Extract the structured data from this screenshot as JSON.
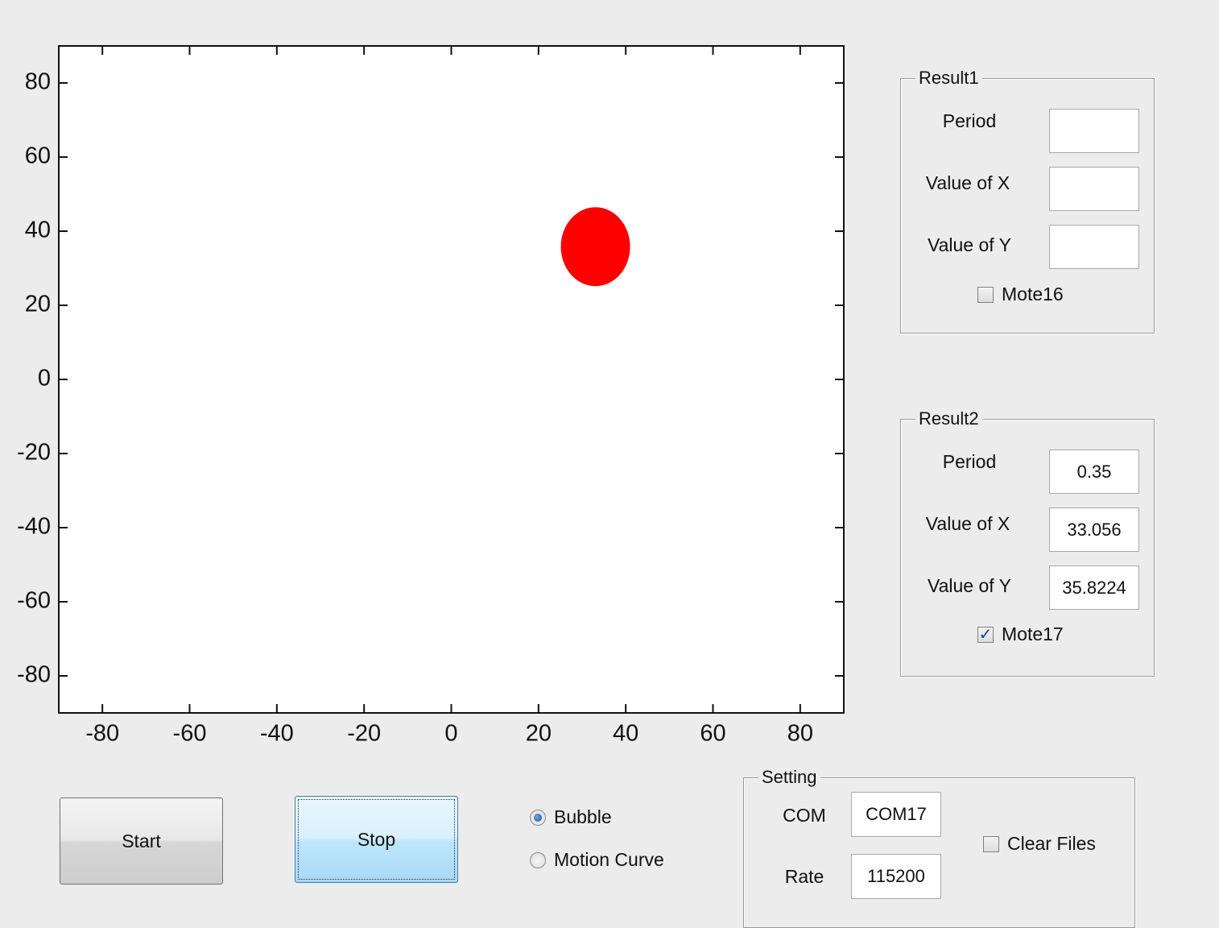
{
  "chart_data": {
    "type": "scatter",
    "xlim": [
      -90,
      90
    ],
    "ylim": [
      -90,
      90
    ],
    "xticks": [
      -80,
      -60,
      -40,
      -20,
      0,
      20,
      40,
      60,
      80
    ],
    "yticks": [
      80,
      60,
      40,
      20,
      0,
      -20,
      -40,
      -60,
      -80
    ],
    "points": [
      {
        "x": 33.056,
        "y": 35.8224
      }
    ],
    "marker_color": "#ff0000",
    "marker": "filled circle",
    "grid": false
  },
  "result1": {
    "title": "Result1",
    "period_label": "Period",
    "x_label": "Value of X",
    "y_label": "Value of Y",
    "period_value": "",
    "x_value": "",
    "y_value": "",
    "mote_label": "Mote16",
    "mote_checked": false
  },
  "result2": {
    "title": "Result2",
    "period_label": "Period",
    "x_label": "Value of X",
    "y_label": "Value of Y",
    "period_value": "0.35",
    "x_value": "33.056",
    "y_value": "35.8224",
    "mote_label": "Mote17",
    "mote_checked": true
  },
  "buttons": {
    "start_label": "Start",
    "stop_label": "Stop"
  },
  "mode": {
    "bubble_label": "Bubble",
    "motion_label": "Motion Curve",
    "selected": "Bubble"
  },
  "setting": {
    "title": "Setting",
    "com_label": "COM",
    "com_value": "COM17",
    "rate_label": "Rate",
    "rate_value": "115200",
    "clear_label": "Clear Files",
    "clear_checked": false
  }
}
